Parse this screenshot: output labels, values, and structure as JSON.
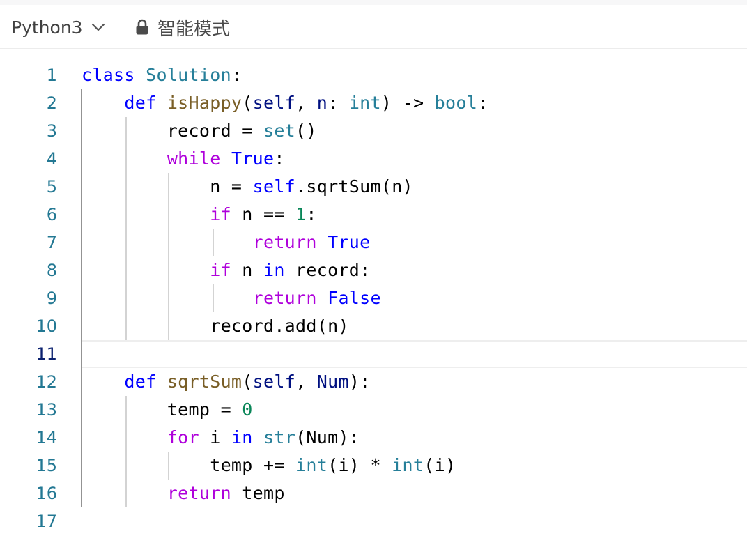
{
  "toolbar": {
    "language": "Python3",
    "mode_label": "智能模式"
  },
  "editor": {
    "line_numbers": [
      "1",
      "2",
      "3",
      "4",
      "5",
      "6",
      "7",
      "8",
      "9",
      "10",
      "11",
      "12",
      "13",
      "14",
      "15",
      "16",
      "17"
    ],
    "active_line": 11,
    "lines": [
      "class Solution:",
      "    def isHappy(self, n: int) -> bool:",
      "        record = set()",
      "        while True:",
      "            n = self.sqrtSum(n)",
      "            if n == 1:",
      "                return True",
      "            if n in record:",
      "                return False",
      "            record.add(n)",
      "",
      "    def sqrtSum(self, Num):",
      "        temp = 0",
      "        for i in str(Num):",
      "            temp += int(i) * int(i)",
      "        return temp",
      ""
    ]
  },
  "colors": {
    "keyword": "#0000ff",
    "control": "#af00db",
    "type": "#267f99",
    "function": "#795e26",
    "parameter": "#001080",
    "number": "#098658",
    "line_number": "#237893"
  }
}
